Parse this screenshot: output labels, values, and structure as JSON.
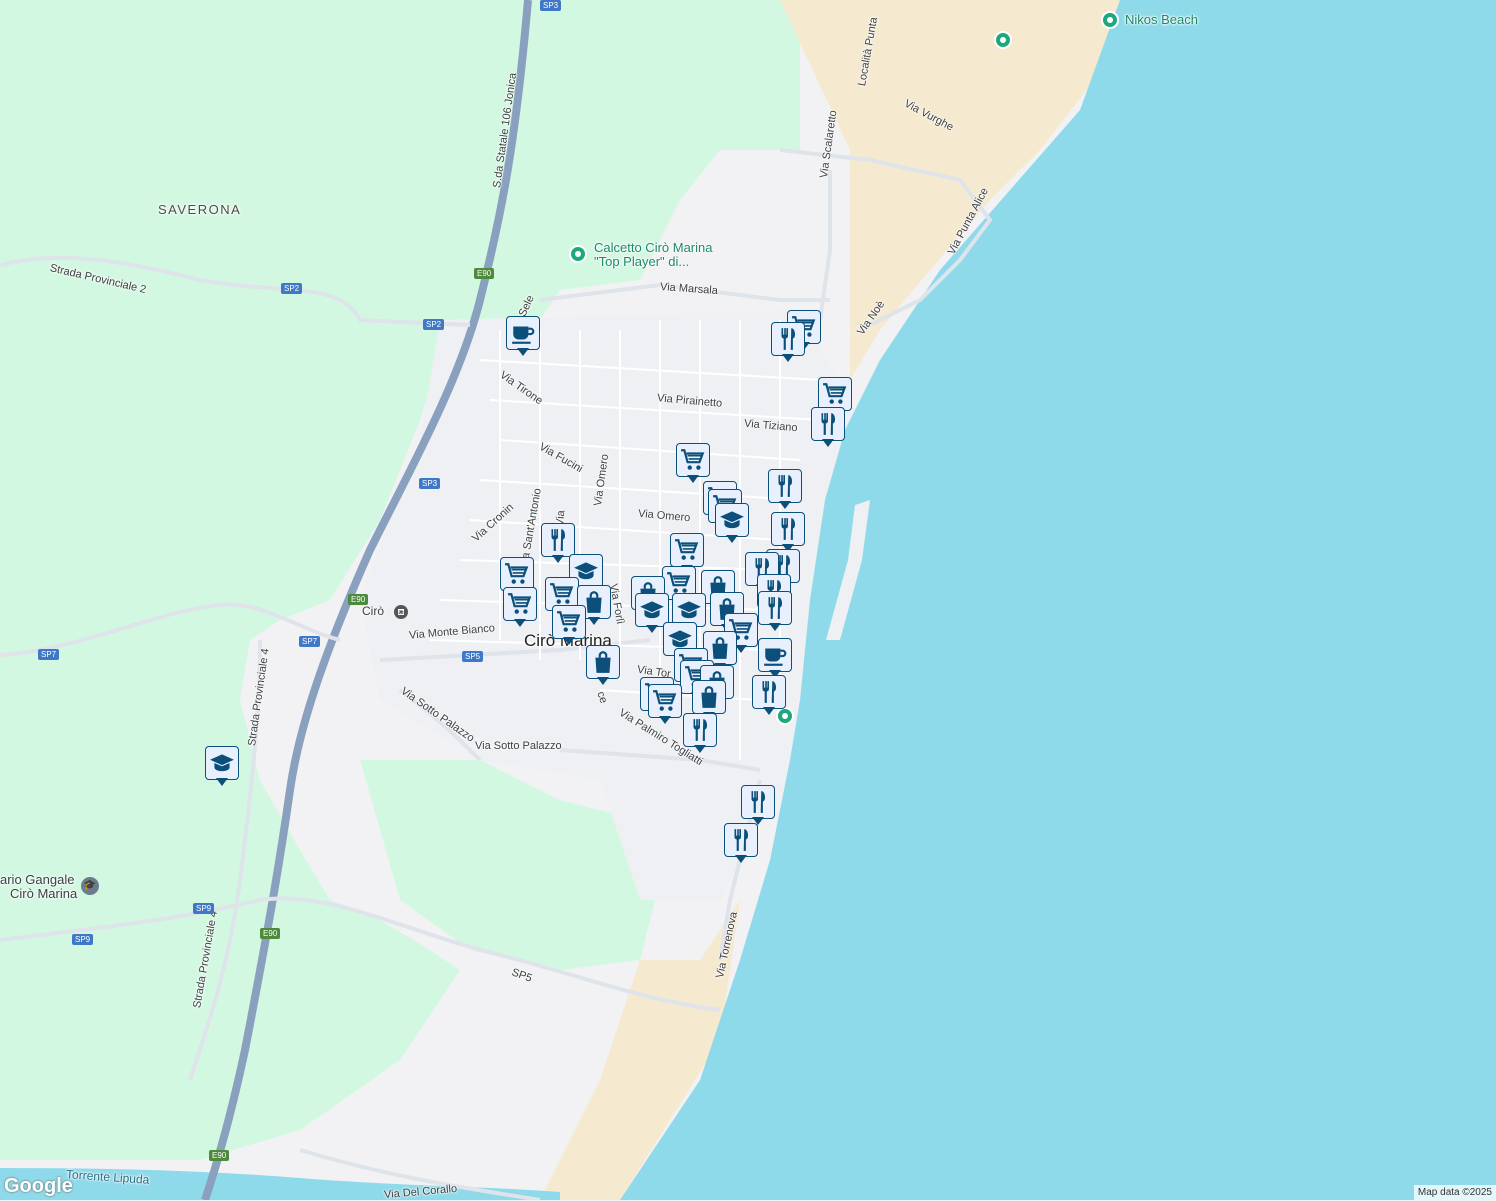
{
  "map": {
    "colors": {
      "land": "#f2f2f4",
      "green": "#d3f8e2",
      "water": "#8fdaea",
      "beach": "#f5ead0",
      "road": "#ffffff",
      "highway": "#8aa0bf",
      "river": "#8fdaea"
    },
    "places": {
      "saverona": "SAVERONA",
      "city": "Cirò Marina",
      "ciro_station": "Cirò"
    },
    "pois": {
      "nikos_beach": "Nikos Beach",
      "calcetto_line1": "Calcetto Cirò Marina",
      "calcetto_line2": "\"Top Player\" di...",
      "gangale_line1": "ario Gangale",
      "gangale_line2": "Cirò Marina"
    },
    "roads": {
      "strada_prov_2": "Strada Provinciale 2",
      "statale_106": "S.da Statale 106 Jonica",
      "via_marsala": "Via Marsala",
      "via_scalaretto_n": "Via Scalaretto",
      "via_scalaretto": "Scalaretto",
      "localita_punta": "Località Punta",
      "via_vurghe": "Via Vurghe",
      "via_punta_alice": "Via Punta Alice",
      "via_noe": "Via Noè",
      "via_tirone": "Via Tirone",
      "via_pirainetto": "Via Pirainetto",
      "via_tiziano": "Via Tiziano",
      "via_fucini": "Via Fucini",
      "via_omero_v": "Via Omero",
      "via_omero": "Via Omero",
      "via_cronin": "Via Cronin",
      "via_sant_antonio": "Via Sant'Antonio",
      "via_forli": "Via Forlì",
      "via_monte_bianco": "Via Monte Bianco",
      "via_sotto_palazzo_1": "Via Sotto Palazzo",
      "via_sotto_palazzo_2": "Via Sotto Palazzo",
      "via_palmiro": "Via Palmiro Togliatti",
      "strada_prov_4a": "Strada Provinciale 4",
      "strada_prov_4b": "Strada Provinciale 4",
      "via_torrenova": "Via Torrenova",
      "sp5_road": "SP5",
      "torrente": "Torrente Lipuda",
      "via_del_corallo": "Via Del Corallo",
      "via_sele": "Sele",
      "via_short": "Via",
      "via_tor": "Via Tor",
      "via_ce": "ce"
    },
    "shields": {
      "sp3_top": "SP3",
      "e90_a": "E90",
      "sp2_a": "SP2",
      "sp2_b": "SP2",
      "sp3_mid": "SP3",
      "e90_b": "E90",
      "sp7": "SP7",
      "sp5": "SP5",
      "sp9_a": "SP9",
      "sp9_b": "SP9",
      "e90_c": "E90",
      "e90_d": "E90",
      "sp7_b": "SP7"
    },
    "attribution": "Map data ©2025",
    "logo": "Google"
  }
}
